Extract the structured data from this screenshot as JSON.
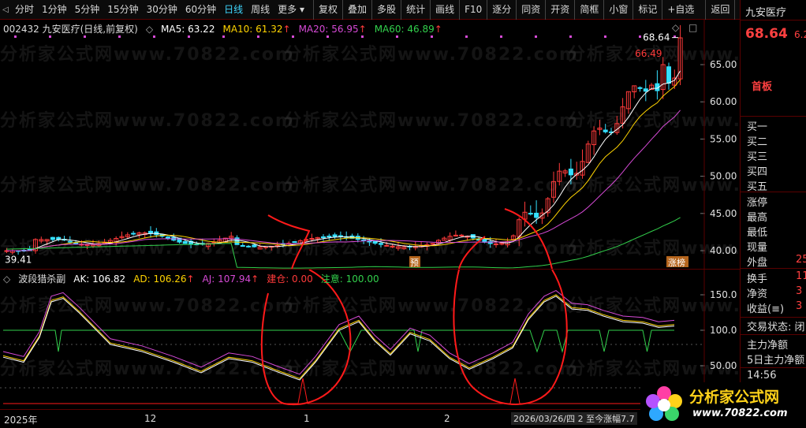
{
  "toolbar": {
    "back": "◁",
    "periods": [
      {
        "label": "分时",
        "active": false
      },
      {
        "label": "1分钟",
        "active": false
      },
      {
        "label": "5分钟",
        "active": false
      },
      {
        "label": "15分钟",
        "active": false
      },
      {
        "label": "30分钟",
        "active": false
      },
      {
        "label": "60分钟",
        "active": false
      },
      {
        "label": "日线",
        "active": true
      },
      {
        "label": "周线",
        "active": false
      },
      {
        "label": "更多 ▾",
        "active": false
      }
    ],
    "buttons": [
      "复权",
      "叠加",
      "多股",
      "统计",
      "画线",
      "F10",
      "逐分",
      "同资",
      "开资",
      "简框",
      "小窗",
      "标记",
      "+自选",
      "返回"
    ]
  },
  "main_legend": {
    "code_name": "002432 九安医疗(日线,前复权)",
    "dropdown": "◇",
    "ma5": "MA5: 63.22",
    "ma10": "MA10: 61.32",
    "ma20": "MA20: 56.95",
    "ma60": "MA60: 46.89",
    "up_arrow": "↑"
  },
  "main_chart": {
    "y_ticks": [
      "65.00",
      "60.00",
      "55.00",
      "50.00",
      "45.00",
      "40.00"
    ],
    "high_label": "68.64",
    "high2_label": "66.49",
    "low_label": "39.41",
    "mark_yu": "预",
    "mark_zhangbang": "涨榜",
    "top_right_icons": [
      "◇",
      "□"
    ]
  },
  "ind_legend": {
    "name": "波段猎杀副",
    "ak": "AK: 106.82",
    "ad": "AD: 106.26",
    "aj": "AJ: 107.94",
    "jiancang": "建仓: 0.00",
    "zhuyi": "注意: 100.00"
  },
  "ind_chart": {
    "y_ticks": [
      "150.0",
      "100.0",
      "50.00"
    ]
  },
  "time_axis": {
    "labels": [
      "2025年",
      "12",
      "1",
      "2"
    ],
    "date_tip": "2026/03/26/四  2  至今涨幅7.7"
  },
  "watermarks": [
    "分析家公式网www.70822.com",
    "分析家公式网www.70822.com"
  ],
  "sidebar": {
    "name": "九安医疗",
    "price": "68.64",
    "change": "6.2",
    "board": "首板",
    "bids": [
      "买一",
      "买二",
      "买三",
      "买四",
      "买五"
    ],
    "stats": [
      {
        "label": "涨停",
        "value": ""
      },
      {
        "label": "最高",
        "value": ""
      },
      {
        "label": "最低",
        "value": ""
      },
      {
        "label": "现量",
        "value": ""
      },
      {
        "label": "外盘",
        "value": "25"
      },
      {
        "label": "换手",
        "value": "11"
      },
      {
        "label": "净资",
        "value": "3"
      },
      {
        "label": "收益(≡)",
        "value": "3"
      }
    ],
    "trade_status": "交易状态: 闭",
    "main_net": "主力净额",
    "main_net5": "5日主力净额",
    "time": "14:56"
  },
  "logo": {
    "title": "分析家公式网",
    "url": "www.70822.com"
  },
  "colors": {
    "up": "#ff3a3a",
    "down": "#35e0ff",
    "ma5": "#ffffff",
    "ma10": "#ffd400",
    "ma20": "#d64ad6",
    "ma60": "#32d04c"
  }
}
